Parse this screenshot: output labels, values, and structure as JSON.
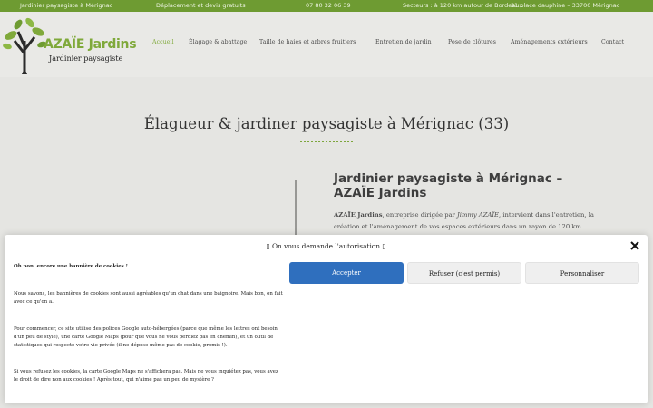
{
  "topbar": {
    "item1": "Jardinier paysagiste à Mérignac",
    "item2": "Déplacement et devis gratuits",
    "item3": "07 80 32 06 39",
    "item4": "Secteurs : à 120 km autour de Bordeaux",
    "item5": "31 place dauphine – 33700 Mérignac"
  },
  "logo": {
    "title": "AZAÏE Jardins",
    "subtitle": "Jardinier paysagiste"
  },
  "nav": {
    "items": [
      "Accueil",
      "Élagage & abattage",
      "Taille de haies et arbres fruitiers",
      "Entretien de jardin",
      "Pose de clôtures",
      "Aménagements extérieurs",
      "Contact"
    ]
  },
  "colors": {
    "accent": "#7fa93a",
    "topbar": "#6e9b32",
    "primary_button": "#2f6fbe"
  },
  "main": {
    "title": "Élagueur & jardiner paysagiste à Mérignac (33)",
    "section_title": "Jardinier paysagiste à Mérignac – AZAÏE Jardins",
    "p_brand": "AZAÏE Jardins",
    "p_text1": ", entreprise dirigée par ",
    "p_person": "Jimmy AZAÏE",
    "p_text2": ", intervient dans l'entretien, la création et l'aménagement de vos espaces extérieurs dans un rayon de 120 km"
  },
  "cookie": {
    "title": "On vous demande l'autorisation",
    "p1": "Oh non, encore une bannière de cookies !",
    "p2": "Nous savons, les bannières de cookies sont aussi agréables qu'un chat dans une baignoire. Mais bon, on fait avec ce qu'on a.",
    "p3": "Pour commencer, ce site utilise des polices Google auto-hébergées (parce que même les lettres ont besoin d'un peu de style), une carte Google Maps (pour que vous ne vous perdiez pas en chemin), et un outil de statistiques qui respecte votre vie privée (il ne dépose même pas de cookie, promis !).",
    "p4": "Si vous refusez les cookies, la carte Google Maps ne s'affichera pas. Mais ne vous inquiétez pas, vous avez le droit de dire non aux cookies ! Après tout, qui n'aime pas un peu de mystère ?",
    "accept_label": "Accepter",
    "refuse_label": "Refuser (c'est permis)",
    "customize_label": "Personnaliser"
  }
}
